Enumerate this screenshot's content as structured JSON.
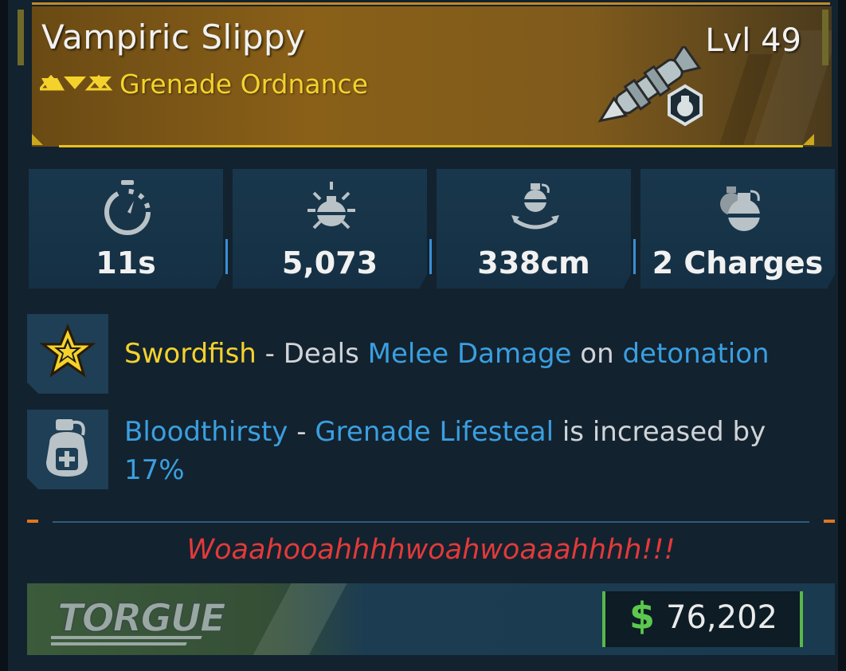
{
  "item": {
    "name": "Vampiric Slippy",
    "type": "Grenade Ordnance",
    "level": "Lvl 49",
    "rarity_color": "#f4d22c",
    "art_icon": "grenade-missile-icon"
  },
  "stats": [
    {
      "icon": "stopwatch-icon",
      "value": "11s"
    },
    {
      "icon": "grenade-burst-icon",
      "value": "5,073"
    },
    {
      "icon": "grenade-radius-icon",
      "value": "338cm"
    },
    {
      "icon": "grenade-charges-icon",
      "value": "2 Charges"
    }
  ],
  "perks": [
    {
      "icon": "star-burst-icon",
      "name": "Swordfish",
      "sep1": " - Deals ",
      "k1": "Melee Damage",
      "sep2": " on ",
      "k2": "detonation"
    },
    {
      "icon": "grenade-heal-icon",
      "name": "Bloodthirsty",
      "sep1": " - ",
      "k1": "Grenade Lifesteal",
      "sep2": " is increased by",
      "k2": "17%"
    }
  ],
  "flavor_text": "Woaahooahhhhwoahwoaaahhhh!!!",
  "manufacturer": {
    "name": "TORGUE",
    "icon": "torgue-logo"
  },
  "price": {
    "currency": "$",
    "value": "76,202"
  },
  "colors": {
    "accent_gold": "#e8c21e",
    "accent_blue": "#3a9fe0",
    "flavor_red": "#e23a3a",
    "price_green": "#5cc84e"
  }
}
